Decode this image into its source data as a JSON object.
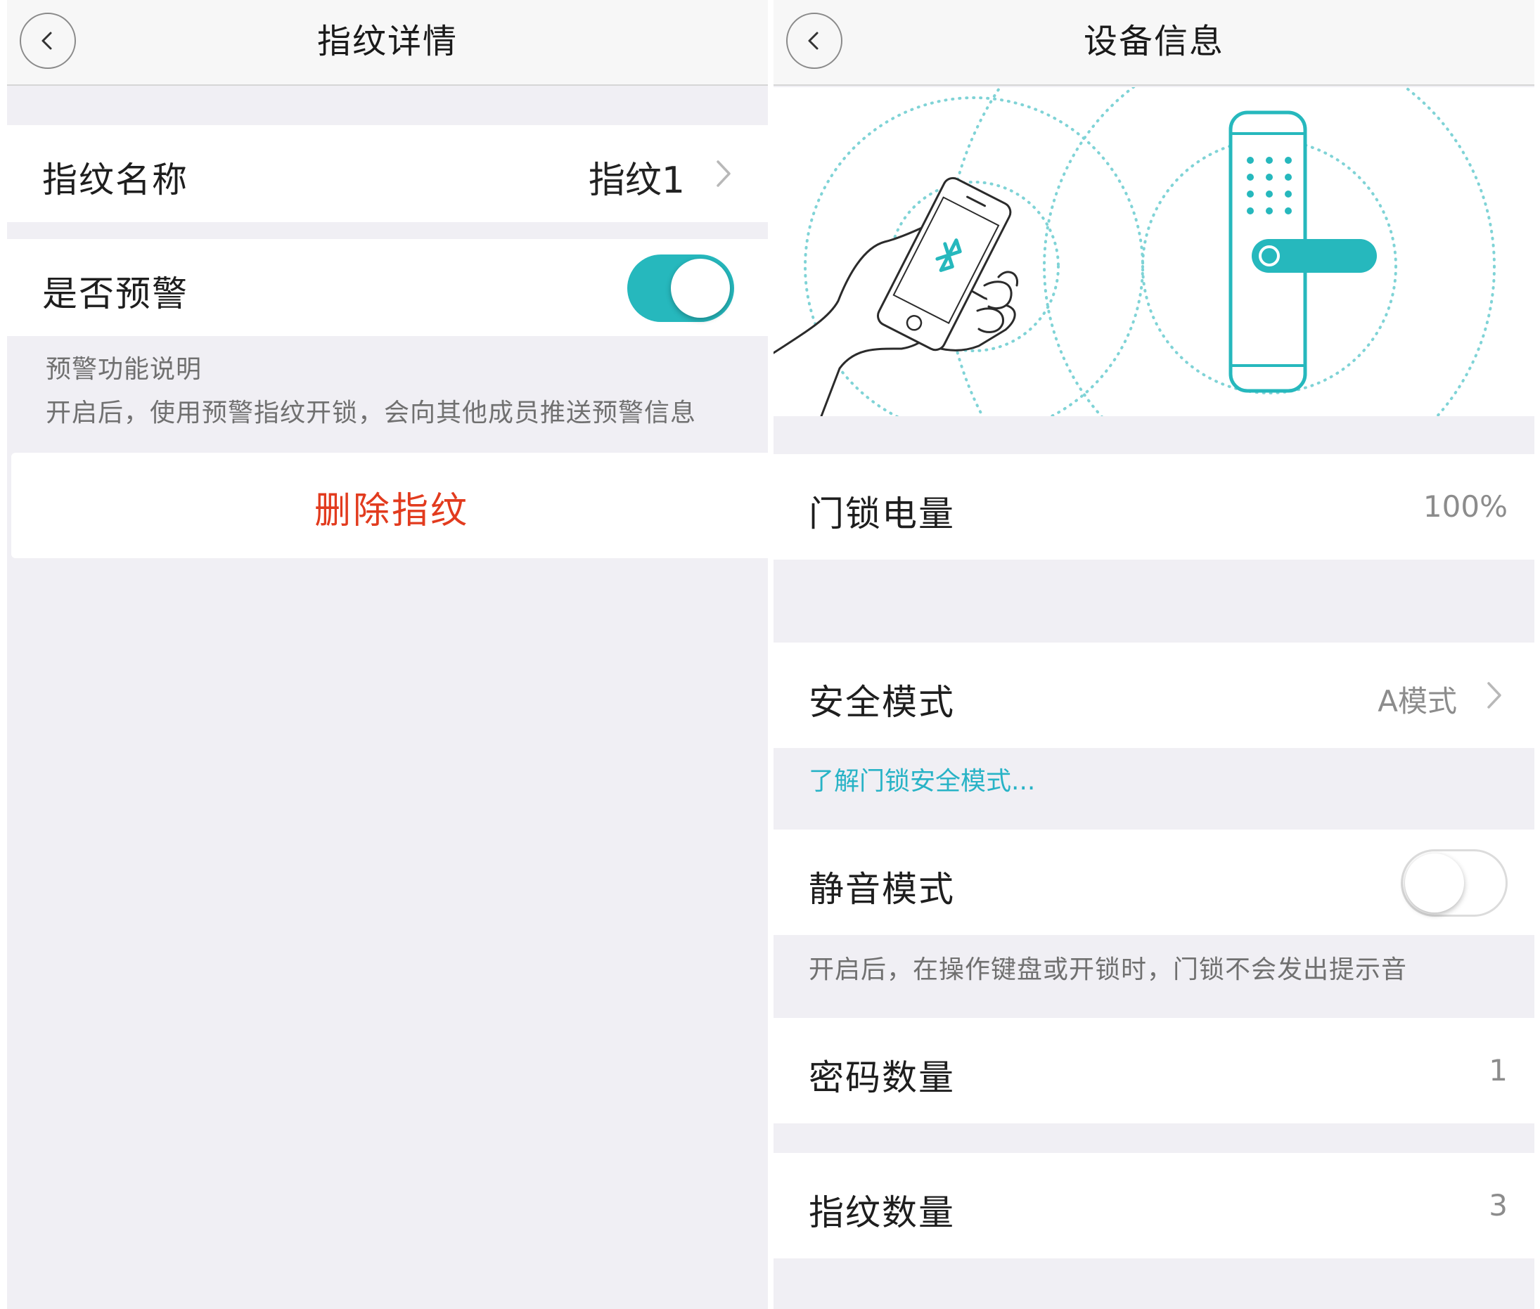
{
  "fingerprint_detail": {
    "title": "指纹详情",
    "name_label": "指纹名称",
    "name_value": "指纹1",
    "alert_label": "是否预警",
    "alert_enabled": true,
    "alert_note_title": "预警功能说明",
    "alert_note_body": "开启后，使用预警指纹开锁，会向其他成员推送预警信息",
    "delete_label": "删除指纹",
    "delete_color": "#e23b1e"
  },
  "device_info": {
    "title": "设备信息",
    "battery_label": "门锁电量",
    "battery_value": "100%",
    "security_label": "安全模式",
    "security_value": "A模式",
    "security_link": "了解门锁安全模式...",
    "mute_label": "静音模式",
    "mute_enabled": false,
    "mute_note": "开启后，在操作键盘或开锁时，门锁不会发出提示音",
    "password_count_label": "密码数量",
    "password_count_value": "1",
    "fingerprint_count_label": "指纹数量",
    "fingerprint_count_value": "3"
  },
  "colors": {
    "accent": "#26b8bd",
    "background": "#f0eff4",
    "link": "#28b3c6"
  }
}
